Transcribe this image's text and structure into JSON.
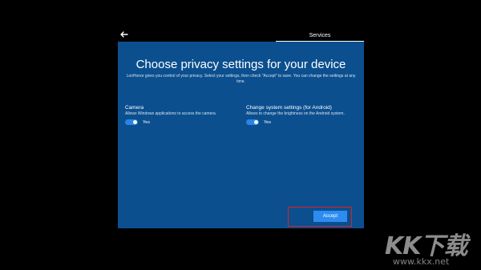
{
  "header": {
    "back_icon": "back-arrow-icon",
    "tab_label": "Services"
  },
  "dialog": {
    "title": "Choose privacy settings for your device",
    "subtitle": "LonHonor gives you control of your privacy. Select your settings, then check \"Accept\" to save. You can change the settings at any time.",
    "settings": [
      {
        "title": "Camera",
        "description": "Allows Windows applications to access the camera",
        "toggle_state": "on",
        "toggle_label": "Yes"
      },
      {
        "title": "Change system settings (for Android)",
        "description": "Allows to change the brightness on the Android system.",
        "toggle_state": "on",
        "toggle_label": "Yes"
      }
    ],
    "accept_label": "Accept"
  },
  "watermark": {
    "logo_text": "KK下载",
    "url_text": "www.kkx.net"
  },
  "colors": {
    "background": "#000000",
    "panel": "#0b4f8f",
    "accent": "#2d8cf0",
    "highlight": "#e02020"
  }
}
